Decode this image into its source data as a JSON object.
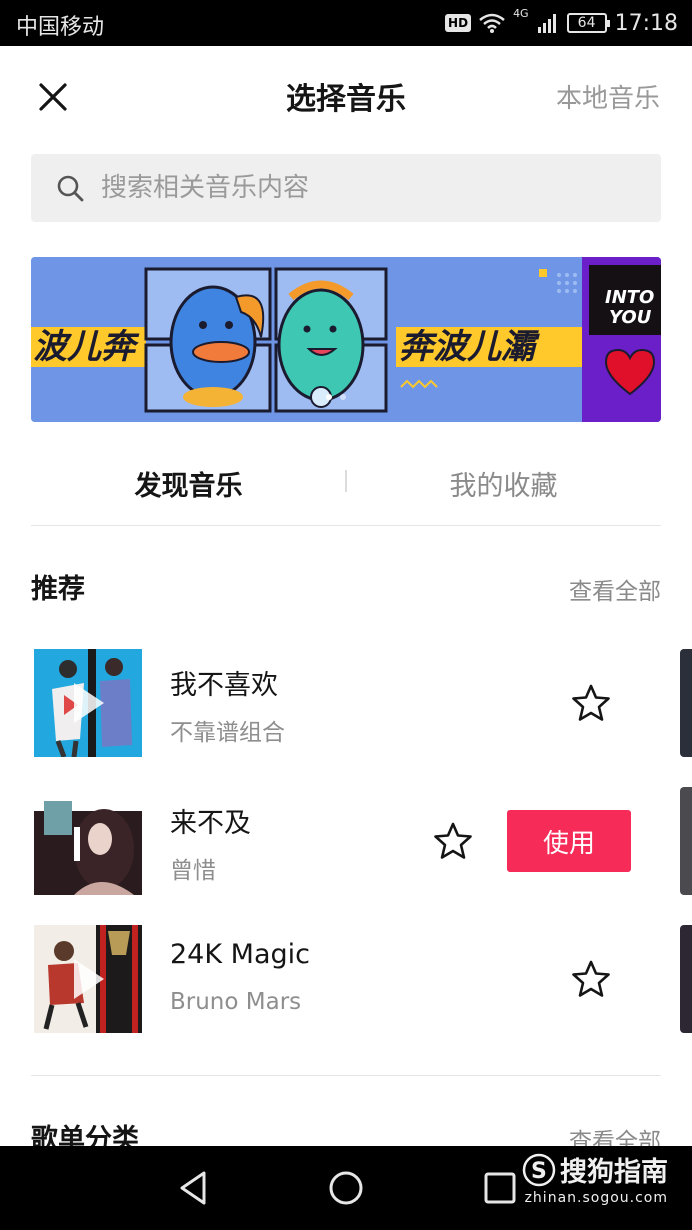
{
  "status_bar": {
    "carrier": "中国移动",
    "hd": "HD",
    "network": "4G",
    "battery": "64",
    "time": "17:18"
  },
  "header": {
    "title": "选择音乐",
    "local_music": "本地音乐"
  },
  "search": {
    "placeholder": "搜索相关音乐内容"
  },
  "banner": {
    "text_left": "波儿奔",
    "text_right": "奔波儿灞",
    "side_text_1": "INTO",
    "side_text_2": "YOU"
  },
  "tabs": [
    {
      "label": "发现音乐",
      "active": true
    },
    {
      "label": "我的收藏",
      "active": false
    }
  ],
  "recommend": {
    "title": "推荐",
    "more": "查看全部",
    "songs": [
      {
        "title": "我不喜欢",
        "artist": "不靠谱组合",
        "selected": false
      },
      {
        "title": "来不及",
        "artist": "曾惜",
        "selected": true
      },
      {
        "title": "24K Magic",
        "artist": "Bruno Mars",
        "selected": false
      }
    ],
    "use_label": "使用"
  },
  "playlist_category": {
    "title": "歌单分类",
    "more": "查看全部"
  },
  "watermark": {
    "brand": "搜狗指南",
    "url": "zhinan.sogou.com"
  },
  "colors": {
    "accent": "#f62b58",
    "banner_bg": "#6f96e6",
    "banner_yellow": "#ffc82b"
  }
}
